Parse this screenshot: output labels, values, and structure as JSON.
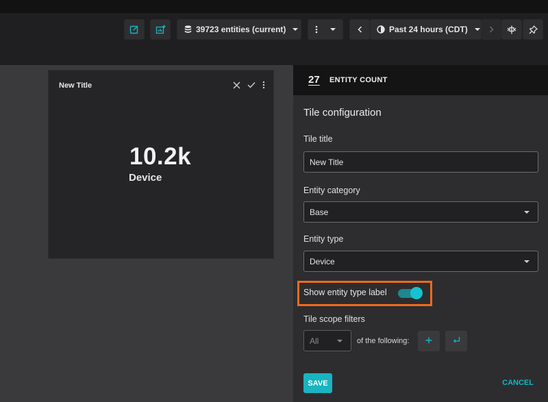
{
  "toolbar": {
    "edit_icon": "edit-icon",
    "add_tile_icon": "add-chart-icon",
    "entities_label": "39723 entities (current)",
    "more_icon": "more-vertical-icon",
    "prev_icon": "chevron-left-icon",
    "time_range_label": "Past 24 hours (CDT)",
    "next_icon": "chevron-right-icon",
    "compare_icon": "timeline-icon",
    "pin_icon": "pin-icon"
  },
  "tile": {
    "title": "New Title",
    "value": "10.2k",
    "type_label": "Device"
  },
  "panel": {
    "header_number": "27",
    "header_title": "ENTITY COUNT",
    "heading": "Tile configuration",
    "tile_title_label": "Tile title",
    "tile_title_value": "New Title",
    "entity_category_label": "Entity category",
    "entity_category_value": "Base",
    "entity_type_label": "Entity type",
    "entity_type_value": "Device",
    "show_type_label": "Show entity type label",
    "show_type_enabled": true,
    "scope_filters_label": "Tile scope filters",
    "scope_match_value": "All",
    "scope_following_text": "of the following:",
    "add_filter_icon": "plus-icon",
    "enter_icon": "enter-icon",
    "save_label": "SAVE",
    "cancel_label": "CANCEL"
  },
  "colors": {
    "accent": "#19b4c0",
    "highlight": "#f26a1b",
    "panel_bg": "#2d2d2f",
    "tile_bg": "#252527"
  }
}
